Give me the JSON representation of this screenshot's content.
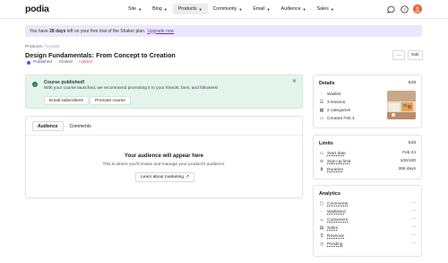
{
  "app": {
    "logo": "podia"
  },
  "nav": [
    {
      "label": "Site",
      "active": false
    },
    {
      "label": "Blog",
      "active": false
    },
    {
      "label": "Products",
      "active": true
    },
    {
      "label": "Community",
      "active": false
    },
    {
      "label": "Email",
      "active": false
    },
    {
      "label": "Audience",
      "active": false
    },
    {
      "label": "Sales",
      "active": false
    }
  ],
  "top_icons": [
    "chat-icon",
    "help-icon",
    "avatar"
  ],
  "trial": {
    "prefix": "You have",
    "days": "28 days",
    "suffix": "left on your free trial of the Shaker plan.",
    "link": "Upgrade now"
  },
  "breadcrumb": {
    "parent": "Products",
    "sep": "/",
    "current": "Course"
  },
  "page": {
    "title": "Design Fundamentals: From Concept to Creation",
    "status": "Published",
    "state": "Closed",
    "visibility": "Hidden",
    "more_label": "···",
    "edit_label": "Edit"
  },
  "published_banner": {
    "title": "Course published!",
    "message": "With your course launched, we recommend promoting it to your friends, fans, and followers!",
    "buttons": [
      "Email subscribers",
      "Promote course"
    ]
  },
  "main": {
    "tabs": [
      {
        "label": "Audience",
        "active": true
      },
      {
        "label": "Comments",
        "active": false
      }
    ],
    "empty_title": "Your audience will appear here",
    "empty_sub": "This is where you'll review and manage your product's audience.",
    "learn_label": "Learn about marketing",
    "learn_arrow": "↗"
  },
  "details": {
    "title": "Details",
    "edit": "Edit",
    "rows": [
      {
        "icon": "waitlist-icon",
        "glyph": "◌",
        "label": "Waitlist"
      },
      {
        "icon": "lessons-icon",
        "glyph": "☰",
        "label": "3 lessons"
      },
      {
        "icon": "categories-icon",
        "glyph": "▦",
        "label": "2 categories"
      },
      {
        "icon": "calendar-icon",
        "glyph": "▭",
        "label": "Created Feb 4"
      }
    ]
  },
  "limits": {
    "title": "Limits",
    "edit": "Edit",
    "rows": [
      {
        "icon": "calendar-icon",
        "glyph": "▭",
        "label": "Start date",
        "value": "Feb 24"
      },
      {
        "icon": "signup-icon",
        "glyph": "⊖",
        "label": "Sign-up limit",
        "value": "100/100"
      },
      {
        "icon": "duration-icon",
        "glyph": "⧗",
        "label": "Duration",
        "value": "365 days"
      }
    ]
  },
  "analytics": {
    "title": "Analytics",
    "rows": [
      {
        "icon": "comments-icon",
        "glyph": "▢",
        "label": "Comments",
        "value": "—"
      },
      {
        "icon": "waitlist-icon",
        "glyph": "◌",
        "label": "Waitlisted",
        "value": "—"
      },
      {
        "icon": "customers-icon",
        "glyph": "☺",
        "label": "Customers",
        "value": "—"
      },
      {
        "icon": "sales-icon",
        "glyph": "▤",
        "label": "Sales",
        "value": "—"
      },
      {
        "icon": "revenue-icon",
        "glyph": "$",
        "label": "Revenue",
        "value": "—"
      },
      {
        "icon": "pending-icon",
        "glyph": "◷",
        "label": "Pending",
        "value": "—"
      }
    ]
  }
}
